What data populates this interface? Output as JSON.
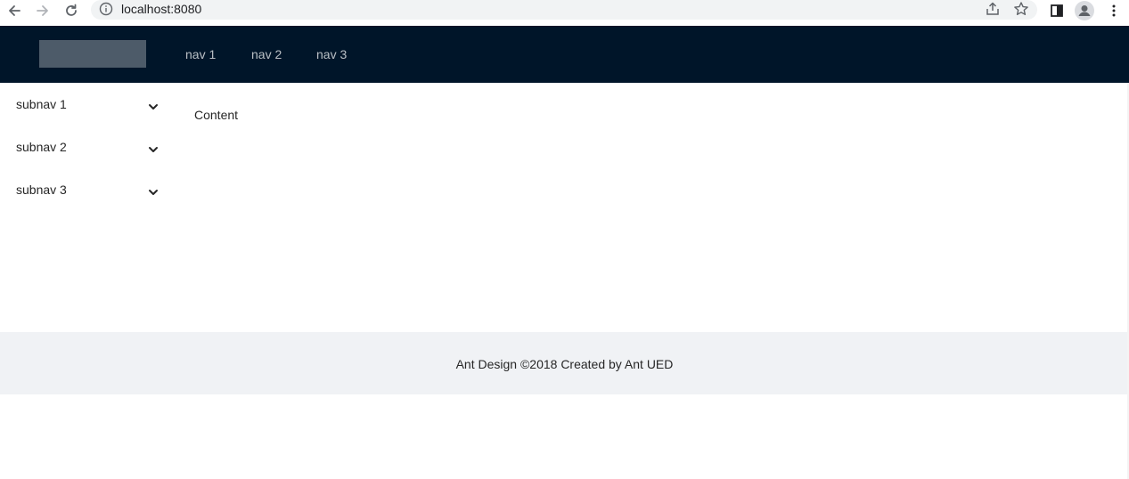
{
  "browser": {
    "url": "localhost:8080",
    "icons": [
      "back-arrow-icon",
      "forward-arrow-icon",
      "reload-icon",
      "info-icon",
      "share-icon",
      "star-icon",
      "side-panel-icon",
      "profile-icon",
      "kebab-menu-icon"
    ]
  },
  "header": {
    "nav": [
      "nav 1",
      "nav 2",
      "nav 3"
    ],
    "bg_color": "#001529"
  },
  "sider": {
    "items": [
      {
        "label": "subnav 1"
      },
      {
        "label": "subnav 2"
      },
      {
        "label": "subnav 3"
      }
    ]
  },
  "content": {
    "text": "Content"
  },
  "footer": {
    "text": "Ant Design ©2018 Created by Ant UED",
    "bg_color": "#f0f2f5"
  }
}
